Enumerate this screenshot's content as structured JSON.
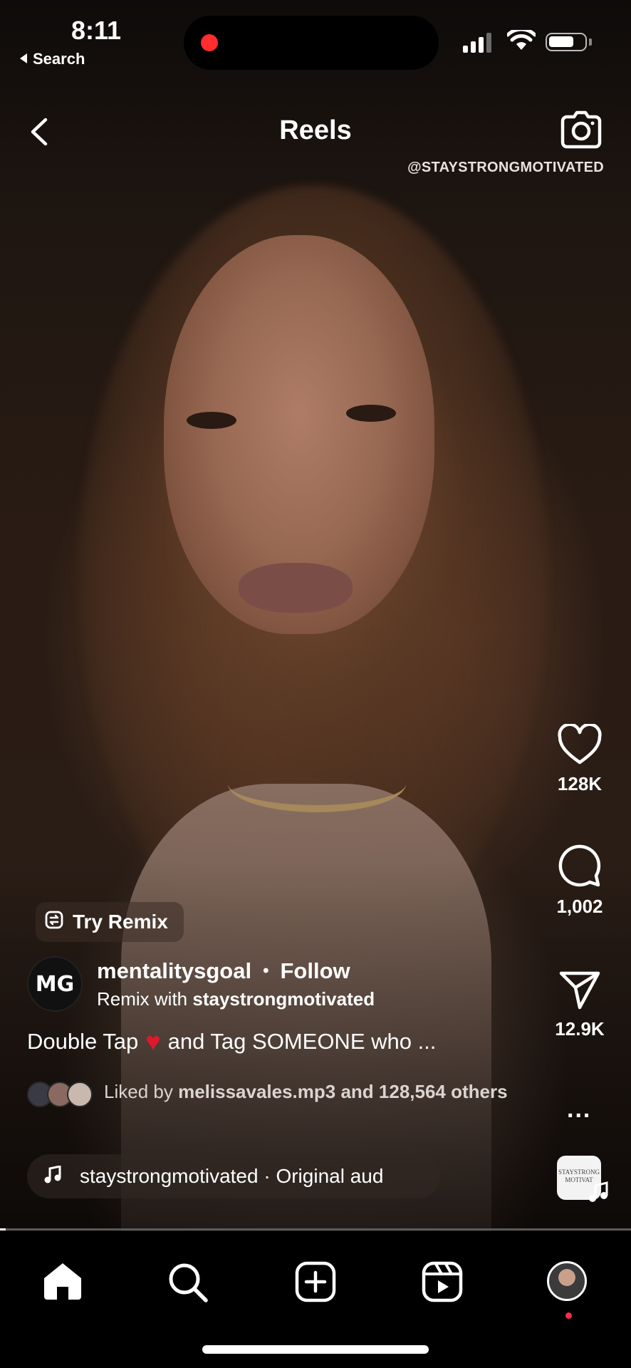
{
  "status_bar": {
    "time": "8:11",
    "back_app_label": "Search",
    "recording_color": "#ff2d2d"
  },
  "header": {
    "title": "Reels",
    "watermark": "@STAYSTRONGMOTIVATED"
  },
  "actions": {
    "likes_count": "128K",
    "comments_count": "1,002",
    "shares_count": "12.9K",
    "more_label": "...",
    "audio_thumb_text": "STAYSTRONG MOTIVAT"
  },
  "post": {
    "remix_label": "Try Remix",
    "avatar_initials": "MG",
    "username": "mentalitysgoal",
    "follow_label": "Follow",
    "remix_prefix": "Remix with ",
    "remix_user": "staystrongmotivated",
    "caption_start": "Double Tap",
    "caption_end": "and Tag SOMEONE who ...",
    "liked_prefix": "Liked by ",
    "liked_user": "melissavales.mp3",
    "liked_suffix": " and 128,564 others",
    "audio_text": "staystrongmotivated · Original aud"
  },
  "colors": {
    "accent_red": "#e0182d",
    "notification_dot": "#ff2a4b"
  },
  "nav": {
    "items": [
      "home-icon",
      "search-icon",
      "create-icon",
      "reels-icon",
      "profile-avatar"
    ]
  }
}
